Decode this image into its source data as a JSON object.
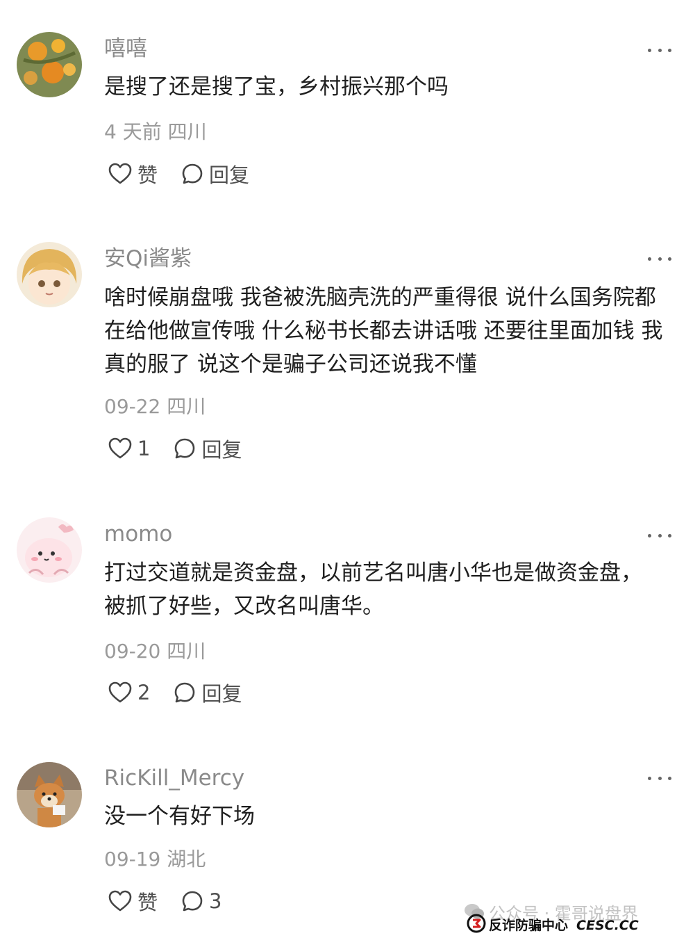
{
  "comments": [
    {
      "username": "嘻嘻",
      "text": "是搜了还是搜了宝，乡村振兴那个吗",
      "meta": "4 天前 四川",
      "like_label": "赞",
      "reply_label": "回复"
    },
    {
      "username": "安Qi酱紫",
      "text": "啥时候崩盘哦 我爸被洗脑壳洗的严重得很 说什么国务院都在给他做宣传哦 什么秘书长都去讲话哦 还要往里面加钱 我真的服了 说这个是骗子公司还说我不懂",
      "meta": "09-22 四川",
      "like_label": "1",
      "reply_label": "回复"
    },
    {
      "username": "momo",
      "text": "打过交道就是资金盘，以前艺名叫唐小华也是做资金盘，被抓了好些，又改名叫唐华。",
      "meta": "09-20 四川",
      "like_label": "2",
      "reply_label": "回复"
    },
    {
      "username": "RicKill_Mercy",
      "text": "没一个有好下场",
      "meta": "09-19 湖北",
      "like_label": "赞",
      "reply_label": "3"
    }
  ],
  "watermark": {
    "line1": "公众号 · 霍哥说盘界",
    "line2": "反诈防骗中心",
    "site": "CESC.CC"
  }
}
